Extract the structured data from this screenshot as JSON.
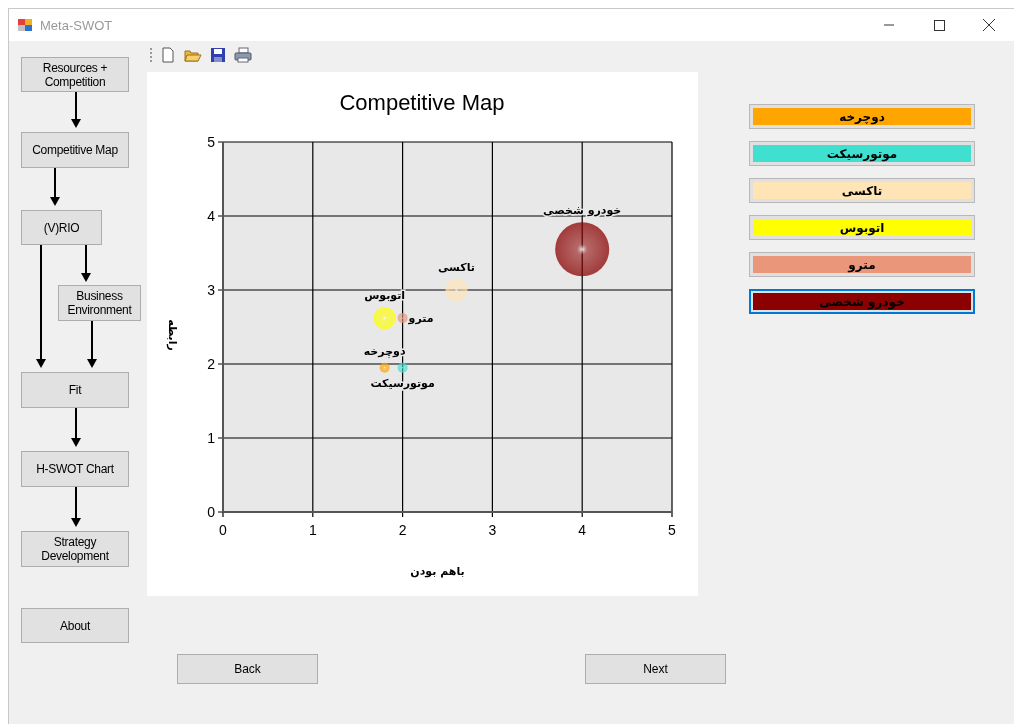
{
  "window": {
    "title": "Meta-SWOT"
  },
  "flowchart": {
    "nodes": [
      {
        "label": "Resources +\nCompetition"
      },
      {
        "label": "Competitive Map"
      },
      {
        "label": "(V)RIO"
      },
      {
        "label": "Business\nEnvironment"
      },
      {
        "label": "Fit"
      },
      {
        "label": "H-SWOT Chart"
      },
      {
        "label": "Strategy\nDevelopment"
      }
    ]
  },
  "about_button": "About",
  "chart": {
    "chart_data": {
      "type": "scatter",
      "title": "Competitive Map",
      "xlabel": "باهم بودن",
      "ylabel": "رابطه",
      "xlim": [
        0,
        5
      ],
      "ylim": [
        0,
        5
      ],
      "xticks": [
        0,
        1,
        2,
        3,
        4,
        5
      ],
      "yticks": [
        0,
        1,
        2,
        3,
        4,
        5
      ],
      "grid": true,
      "series": [
        {
          "name": "دوچرخه",
          "color": "#ffa500",
          "x": [
            1.8
          ],
          "values": [
            1.95
          ]
        },
        {
          "name": "موتورسیکت",
          "color": "#40e0d0",
          "x": [
            2.0
          ],
          "values": [
            1.95
          ]
        },
        {
          "name": "تاکسی",
          "color": "#ffe4b5",
          "x": [
            2.6
          ],
          "values": [
            3.0
          ]
        },
        {
          "name": "اتوبوس",
          "color": "#ffff00",
          "x": [
            1.8
          ],
          "values": [
            2.62
          ]
        },
        {
          "name": "مترو",
          "color": "#e9967a",
          "x": [
            2.0
          ],
          "values": [
            2.62
          ]
        },
        {
          "name": "خودرو شخصی",
          "color": "#8b0000",
          "x": [
            4.0
          ],
          "values": [
            3.55
          ]
        }
      ]
    }
  },
  "legend": {
    "items": [
      {
        "label": "دوچرخه",
        "color": "#ffa500",
        "selected": false
      },
      {
        "label": "موتورسیکت",
        "color": "#40e0d0",
        "selected": false
      },
      {
        "label": "تاکسی",
        "color": "#ffe4b5",
        "selected": false
      },
      {
        "label": "اتوبوس",
        "color": "#ffff00",
        "selected": false
      },
      {
        "label": "مترو",
        "color": "#e9967a",
        "selected": false
      },
      {
        "label": "خودرو شخصی",
        "color": "#8b0000",
        "selected": true
      }
    ]
  },
  "buttons": {
    "back": "Back",
    "next": "Next"
  }
}
